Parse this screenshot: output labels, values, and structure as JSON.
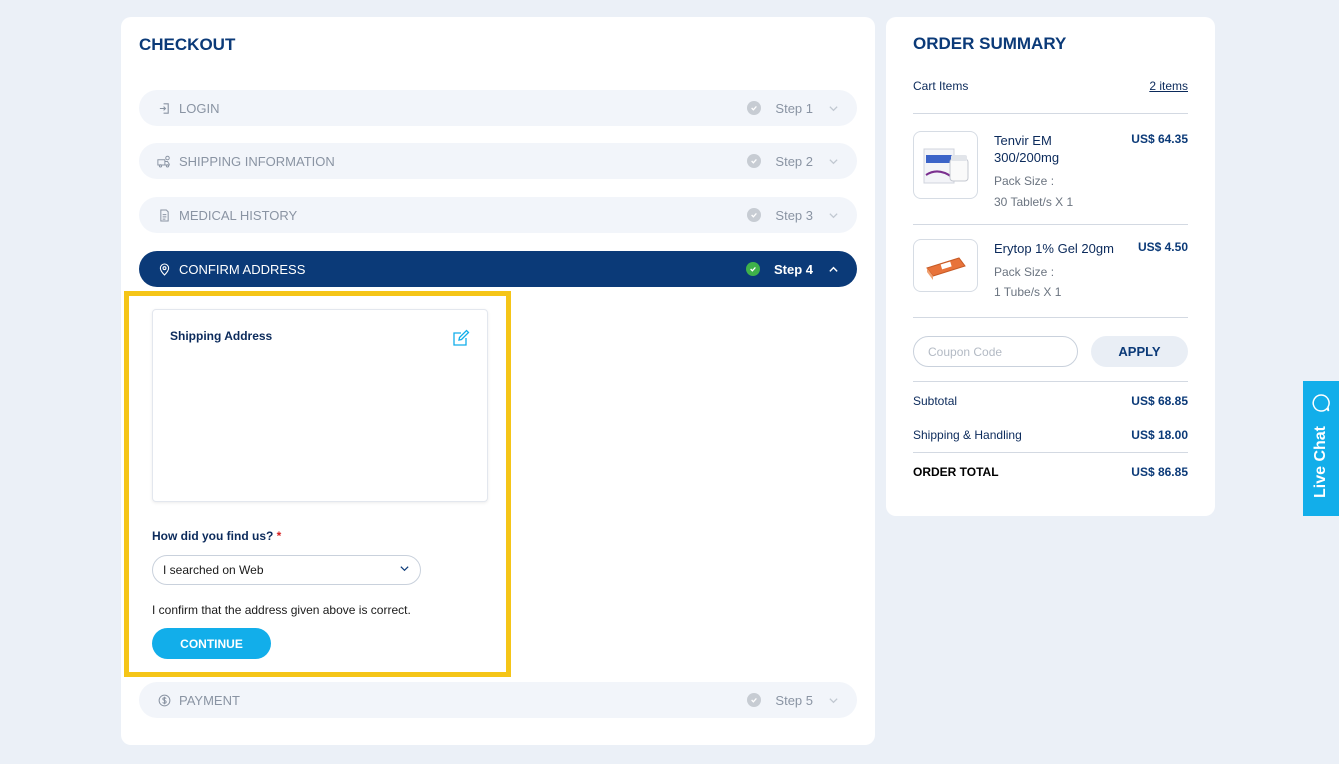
{
  "checkout": {
    "title": "CHECKOUT",
    "steps": [
      {
        "label": "LOGIN",
        "step": "Step 1",
        "icon": "login-icon"
      },
      {
        "label": "SHIPPING INFORMATION",
        "step": "Step 2",
        "icon": "shipping-icon"
      },
      {
        "label": "MEDICAL HISTORY",
        "step": "Step 3",
        "icon": "document-icon"
      },
      {
        "label": "CONFIRM ADDRESS",
        "step": "Step 4",
        "icon": "location-pin-icon"
      },
      {
        "label": "PAYMENT",
        "step": "Step 5",
        "icon": "dollar-icon"
      }
    ],
    "active_step": 4,
    "shipping_address_title": "Shipping Address",
    "find_us_label": "How did you find us?",
    "required_mark": "*",
    "find_us_selected": "I searched on Web",
    "confirm_text": "I confirm that the address given above is correct.",
    "continue_label": "CONTINUE"
  },
  "summary": {
    "title": "ORDER SUMMARY",
    "cart_label": "Cart Items",
    "cart_count": "2 items",
    "items": [
      {
        "name": "Tenvir EM 300/200mg",
        "price": "US$ 64.35",
        "pack_label": "Pack Size :",
        "pack_value": "30 Tablet/s X 1"
      },
      {
        "name": "Erytop 1% Gel 20gm",
        "price": "US$ 4.50",
        "pack_label": "Pack Size :",
        "pack_value": "1 Tube/s X 1"
      }
    ],
    "coupon_placeholder": "Coupon Code",
    "apply_label": "APPLY",
    "subtotal_label": "Subtotal",
    "subtotal_value": "US$ 68.85",
    "shipping_label": "Shipping & Handling",
    "shipping_value": "US$ 18.00",
    "total_label": "ORDER TOTAL",
    "total_value": "US$ 86.85"
  },
  "live_chat": {
    "label": "Live Chat"
  },
  "colors": {
    "primary": "#0b3a78",
    "accent": "#12aeea",
    "highlight": "#f5c518",
    "success": "#3fb24a"
  }
}
